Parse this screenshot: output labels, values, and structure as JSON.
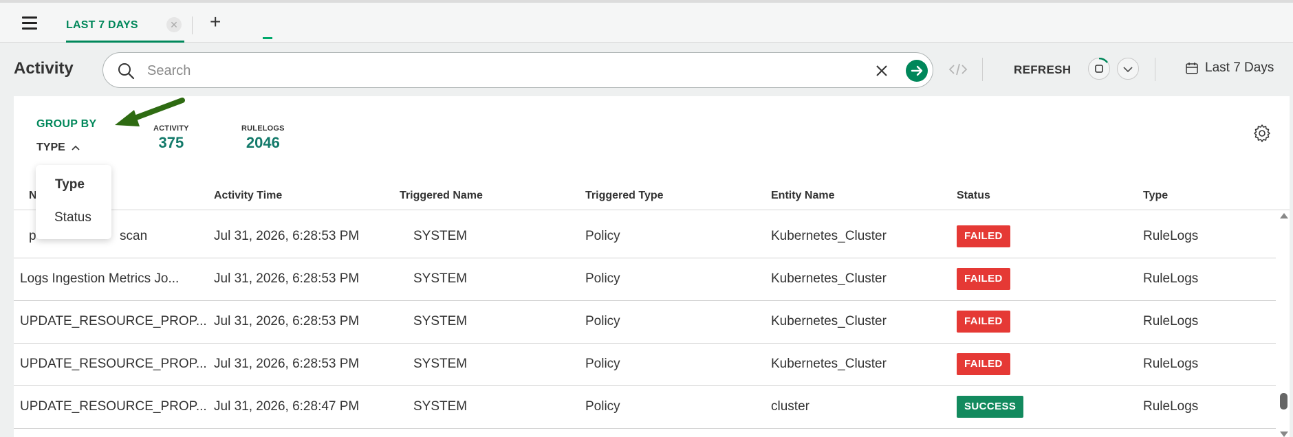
{
  "tabs": [
    {
      "label": "LAST 7 DAYS",
      "active": true
    }
  ],
  "header": {
    "title": "Activity",
    "search": {
      "placeholder": "Search",
      "value": ""
    },
    "refresh_label": "REFRESH",
    "date_range_label": "Last 7 Days"
  },
  "group_by": {
    "title": "GROUP BY",
    "selected": "TYPE",
    "options": [
      "Type",
      "Status"
    ]
  },
  "stats": [
    {
      "label": "ACTIVITY",
      "value": "375"
    },
    {
      "label": "RULELOGS",
      "value": "2046"
    }
  ],
  "table": {
    "columns": [
      "N",
      "Activity Time",
      "Triggered Name",
      "Triggered Type",
      "Entity Name",
      "Status",
      "Type"
    ],
    "rows": [
      {
        "name": "p",
        "name_tail": "scan",
        "time": "Jul 31, 2026, 6:28:53 PM",
        "triggered_name": "SYSTEM",
        "triggered_type": "Policy",
        "entity": "Kubernetes_Cluster",
        "status": "FAILED",
        "type": "RuleLogs"
      },
      {
        "name": "Logs Ingestion Metrics Jo...",
        "time": "Jul 31, 2026, 6:28:53 PM",
        "triggered_name": "SYSTEM",
        "triggered_type": "Policy",
        "entity": "Kubernetes_Cluster",
        "status": "FAILED",
        "type": "RuleLogs"
      },
      {
        "name": "UPDATE_RESOURCE_PROP...",
        "time": "Jul 31, 2026, 6:28:53 PM",
        "triggered_name": "SYSTEM",
        "triggered_type": "Policy",
        "entity": "Kubernetes_Cluster",
        "status": "FAILED",
        "type": "RuleLogs"
      },
      {
        "name": "UPDATE_RESOURCE_PROP...",
        "time": "Jul 31, 2026, 6:28:53 PM",
        "triggered_name": "SYSTEM",
        "triggered_type": "Policy",
        "entity": "Kubernetes_Cluster",
        "status": "FAILED",
        "type": "RuleLogs"
      },
      {
        "name": "UPDATE_RESOURCE_PROP...",
        "time": "Jul 31, 2026, 6:28:47 PM",
        "triggered_name": "SYSTEM",
        "triggered_type": "Policy",
        "entity": "cluster",
        "status": "SUCCESS",
        "type": "RuleLogs"
      }
    ]
  },
  "colors": {
    "accent": "#00875a",
    "failed": "#e53935",
    "success": "#138a5e",
    "annotation_arrow": "#2e6b12"
  },
  "icons": [
    "menu-icon",
    "close-icon",
    "plus-icon",
    "search-icon",
    "clear-icon",
    "arrow-right-icon",
    "code-icon",
    "auto-refresh-icon",
    "chevron-down-icon",
    "calendar-icon",
    "chevron-up-icon",
    "gear-icon"
  ]
}
